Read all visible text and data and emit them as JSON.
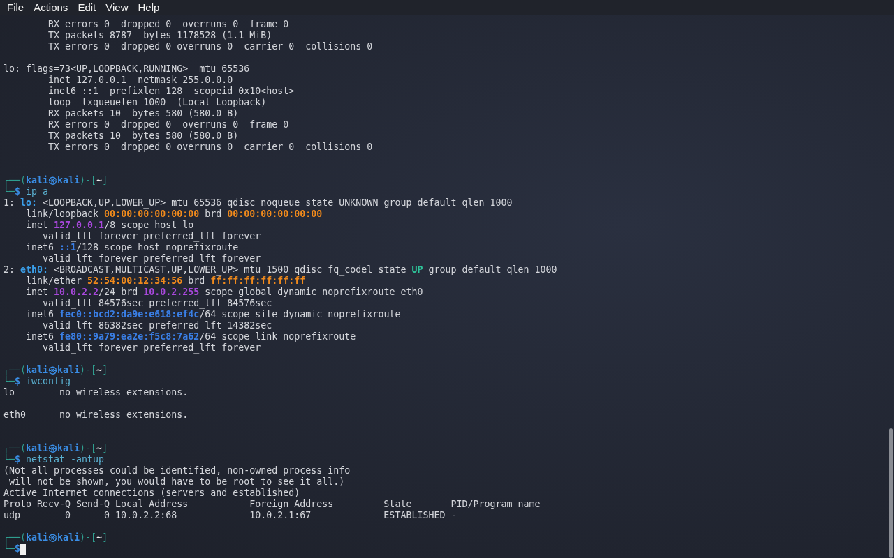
{
  "menu": [
    {
      "label": "File"
    },
    {
      "label": "Actions"
    },
    {
      "label": "Edit"
    },
    {
      "label": "View"
    },
    {
      "label": "Help"
    }
  ],
  "lines": [
    {
      "kind": "output",
      "segments": [
        {
          "text": "        RX errors 0  dropped 0  overruns 0  frame 0",
          "kind": "plain"
        }
      ]
    },
    {
      "kind": "output",
      "segments": [
        {
          "text": "        TX packets 8787  bytes 1178528 (1.1 MiB)",
          "kind": "plain"
        }
      ]
    },
    {
      "kind": "output",
      "segments": [
        {
          "text": "        TX errors 0  dropped 0 overruns 0  carrier 0  collisions 0",
          "kind": "plain"
        }
      ]
    },
    {
      "kind": "blank"
    },
    {
      "kind": "output",
      "segments": [
        {
          "text": "lo: flags=73<UP,LOOPBACK,RUNNING>  mtu 65536",
          "kind": "plain"
        }
      ]
    },
    {
      "kind": "output",
      "segments": [
        {
          "text": "        inet 127.0.0.1  netmask 255.0.0.0",
          "kind": "plain"
        }
      ]
    },
    {
      "kind": "output",
      "segments": [
        {
          "text": "        inet6 ::1  prefixlen 128  scopeid 0x10<host>",
          "kind": "plain"
        }
      ]
    },
    {
      "kind": "output",
      "segments": [
        {
          "text": "        loop  txqueuelen 1000  (Local Loopback)",
          "kind": "plain"
        }
      ]
    },
    {
      "kind": "output",
      "segments": [
        {
          "text": "        RX packets 10  bytes 580 (580.0 B)",
          "kind": "plain"
        }
      ]
    },
    {
      "kind": "output",
      "segments": [
        {
          "text": "        RX errors 0  dropped 0  overruns 0  frame 0",
          "kind": "plain"
        }
      ]
    },
    {
      "kind": "output",
      "segments": [
        {
          "text": "        TX packets 10  bytes 580 (580.0 B)",
          "kind": "plain"
        }
      ]
    },
    {
      "kind": "output",
      "segments": [
        {
          "text": "        TX errors 0  dropped 0 overruns 0  carrier 0  collisions 0",
          "kind": "plain"
        }
      ]
    },
    {
      "kind": "blank"
    },
    {
      "kind": "blank"
    },
    {
      "kind": "output",
      "segments": [
        {
          "text": "┌──(",
          "kind": "frame"
        },
        {
          "text": "kali㉿kali",
          "kind": "userhost"
        },
        {
          "text": ")-[",
          "kind": "frame"
        },
        {
          "text": "~",
          "kind": "dir"
        },
        {
          "text": "]",
          "kind": "frame"
        }
      ]
    },
    {
      "kind": "output",
      "segments": [
        {
          "text": "└─",
          "kind": "frame"
        },
        {
          "text": "$",
          "kind": "dollar"
        },
        {
          "text": " ip a",
          "kind": "command"
        }
      ]
    },
    {
      "kind": "output",
      "segments": [
        {
          "text": "1: ",
          "kind": "plain"
        },
        {
          "text": "lo:",
          "kind": "iface"
        },
        {
          "text": " <LOOPBACK,UP,LOWER_UP> mtu 65536 qdisc noqueue state UNKNOWN group default qlen 1000",
          "kind": "plain"
        }
      ]
    },
    {
      "kind": "output",
      "segments": [
        {
          "text": "    link/loopback ",
          "kind": "plain"
        },
        {
          "text": "00:00:00:00:00:00",
          "kind": "mac"
        },
        {
          "text": " brd ",
          "kind": "plain"
        },
        {
          "text": "00:00:00:00:00:00",
          "kind": "mac"
        }
      ]
    },
    {
      "kind": "output",
      "segments": [
        {
          "text": "    inet ",
          "kind": "plain"
        },
        {
          "text": "127.0.0.1",
          "kind": "ipv4"
        },
        {
          "text": "/8 scope host lo",
          "kind": "plain"
        }
      ]
    },
    {
      "kind": "output",
      "segments": [
        {
          "text": "       valid_lft forever preferred_lft forever",
          "kind": "plain"
        }
      ]
    },
    {
      "kind": "output",
      "segments": [
        {
          "text": "    inet6 ",
          "kind": "plain"
        },
        {
          "text": "::1",
          "kind": "ipv6"
        },
        {
          "text": "/128 scope host noprefixroute",
          "kind": "plain"
        }
      ]
    },
    {
      "kind": "output",
      "segments": [
        {
          "text": "       valid_lft forever preferred_lft forever",
          "kind": "plain"
        }
      ]
    },
    {
      "kind": "output",
      "segments": [
        {
          "text": "2: ",
          "kind": "plain"
        },
        {
          "text": "eth0:",
          "kind": "iface"
        },
        {
          "text": " <BROADCAST,MULTICAST,UP,LOWER_UP> mtu 1500 qdisc fq_codel state ",
          "kind": "plain"
        },
        {
          "text": "UP",
          "kind": "up"
        },
        {
          "text": " group default qlen 1000",
          "kind": "plain"
        }
      ]
    },
    {
      "kind": "output",
      "segments": [
        {
          "text": "    link/ether ",
          "kind": "plain"
        },
        {
          "text": "52:54:00:12:34:56",
          "kind": "mac"
        },
        {
          "text": " brd ",
          "kind": "plain"
        },
        {
          "text": "ff:ff:ff:ff:ff:ff",
          "kind": "mac"
        }
      ]
    },
    {
      "kind": "output",
      "segments": [
        {
          "text": "    inet ",
          "kind": "plain"
        },
        {
          "text": "10.0.2.2",
          "kind": "ipv4"
        },
        {
          "text": "/24 brd ",
          "kind": "plain"
        },
        {
          "text": "10.0.2.255",
          "kind": "ipv4"
        },
        {
          "text": " scope global dynamic noprefixroute eth0",
          "kind": "plain"
        }
      ]
    },
    {
      "kind": "output",
      "segments": [
        {
          "text": "       valid_lft 84576sec preferred_lft 84576sec",
          "kind": "plain"
        }
      ]
    },
    {
      "kind": "output",
      "segments": [
        {
          "text": "    inet6 ",
          "kind": "plain"
        },
        {
          "text": "fec0::bcd2:da9e:e618:ef4c",
          "kind": "ipv6"
        },
        {
          "text": "/64 scope site dynamic noprefixroute",
          "kind": "plain"
        }
      ]
    },
    {
      "kind": "output",
      "segments": [
        {
          "text": "       valid_lft 86382sec preferred_lft 14382sec",
          "kind": "plain"
        }
      ]
    },
    {
      "kind": "output",
      "segments": [
        {
          "text": "    inet6 ",
          "kind": "plain"
        },
        {
          "text": "fe80::9a79:ea2e:f5c8:7a62",
          "kind": "ipv6"
        },
        {
          "text": "/64 scope link noprefixroute",
          "kind": "plain"
        }
      ]
    },
    {
      "kind": "output",
      "segments": [
        {
          "text": "       valid_lft forever preferred_lft forever",
          "kind": "plain"
        }
      ]
    },
    {
      "kind": "blank"
    },
    {
      "kind": "output",
      "segments": [
        {
          "text": "┌──(",
          "kind": "frame"
        },
        {
          "text": "kali㉿kali",
          "kind": "userhost"
        },
        {
          "text": ")-[",
          "kind": "frame"
        },
        {
          "text": "~",
          "kind": "dir"
        },
        {
          "text": "]",
          "kind": "frame"
        }
      ]
    },
    {
      "kind": "output",
      "segments": [
        {
          "text": "└─",
          "kind": "frame"
        },
        {
          "text": "$",
          "kind": "dollar"
        },
        {
          "text": " iwconfig",
          "kind": "command"
        }
      ]
    },
    {
      "kind": "output",
      "segments": [
        {
          "text": "lo        no wireless extensions.",
          "kind": "plain"
        }
      ]
    },
    {
      "kind": "blank"
    },
    {
      "kind": "output",
      "segments": [
        {
          "text": "eth0      no wireless extensions.",
          "kind": "plain"
        }
      ]
    },
    {
      "kind": "blank"
    },
    {
      "kind": "blank"
    },
    {
      "kind": "output",
      "segments": [
        {
          "text": "┌──(",
          "kind": "frame"
        },
        {
          "text": "kali㉿kali",
          "kind": "userhost"
        },
        {
          "text": ")-[",
          "kind": "frame"
        },
        {
          "text": "~",
          "kind": "dir"
        },
        {
          "text": "]",
          "kind": "frame"
        }
      ]
    },
    {
      "kind": "output",
      "segments": [
        {
          "text": "└─",
          "kind": "frame"
        },
        {
          "text": "$",
          "kind": "dollar"
        },
        {
          "text": " netstat -antup",
          "kind": "command"
        }
      ]
    },
    {
      "kind": "output",
      "segments": [
        {
          "text": "(Not all processes could be identified, non-owned process info",
          "kind": "plain"
        }
      ]
    },
    {
      "kind": "output",
      "segments": [
        {
          "text": " will not be shown, you would have to be root to see it all.)",
          "kind": "plain"
        }
      ]
    },
    {
      "kind": "output",
      "segments": [
        {
          "text": "Active Internet connections (servers and established)",
          "kind": "plain"
        }
      ]
    },
    {
      "kind": "output",
      "segments": [
        {
          "text": "Proto Recv-Q Send-Q Local Address           Foreign Address         State       PID/Program name",
          "kind": "plain"
        }
      ]
    },
    {
      "kind": "output",
      "segments": [
        {
          "text": "udp        0      0 10.0.2.2:68             10.0.2.1:67             ESTABLISHED -",
          "kind": "plain"
        }
      ]
    },
    {
      "kind": "blank"
    },
    {
      "kind": "output",
      "segments": [
        {
          "text": "┌──(",
          "kind": "frame"
        },
        {
          "text": "kali㉿kali",
          "kind": "userhost"
        },
        {
          "text": ")-[",
          "kind": "frame"
        },
        {
          "text": "~",
          "kind": "dir"
        },
        {
          "text": "]",
          "kind": "frame"
        }
      ]
    },
    {
      "kind": "output",
      "segments": [
        {
          "text": "└─",
          "kind": "frame"
        },
        {
          "text": "$",
          "kind": "dollar"
        }
      ]
    }
  ],
  "cursor": {
    "visible": true
  }
}
